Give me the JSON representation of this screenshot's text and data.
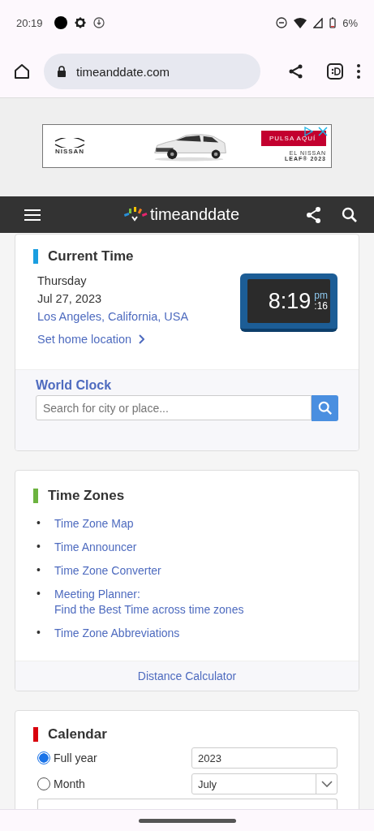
{
  "status_bar": {
    "time": "20:19",
    "battery": "6%"
  },
  "browser": {
    "url": "timeanddate.com"
  },
  "ad": {
    "brand": "NISSAN",
    "cta": "PULSA AQUÍ",
    "tagline_1": "EL NISSAN",
    "tagline_2": "LEAF® 2023"
  },
  "site_header": {
    "logo": "timeanddate"
  },
  "current_time": {
    "title": "Current Time",
    "weekday": "Thursday",
    "date": "Jul 27, 2023",
    "location": "Los Angeles, California, USA",
    "home_link": "Set home location",
    "clock": {
      "time": "8:19",
      "ampm": "pm",
      "seconds": ":16"
    }
  },
  "world_clock": {
    "title": "World Clock",
    "placeholder": "Search for city or place..."
  },
  "time_zones": {
    "title": "Time Zones",
    "links": [
      {
        "bullet": "•",
        "lines": [
          "Time Zone Map"
        ]
      },
      {
        "bullet": "•",
        "lines": [
          "Time Announcer"
        ]
      },
      {
        "bullet": "•",
        "lines": [
          "Time Zone Converter"
        ]
      },
      {
        "bullet": "•",
        "lines": [
          "Meeting Planner:",
          "Find the Best Time across time zones"
        ]
      },
      {
        "bullet": "•",
        "lines": [
          "Time Zone Abbreviations"
        ]
      }
    ],
    "footer_link": "Distance Calculator"
  },
  "calendar": {
    "title": "Calendar",
    "options": [
      {
        "label": "Full year",
        "selected": true,
        "kind": "text",
        "value": "2023"
      },
      {
        "label": "Month",
        "selected": false,
        "kind": "select",
        "value": "July"
      }
    ]
  }
}
